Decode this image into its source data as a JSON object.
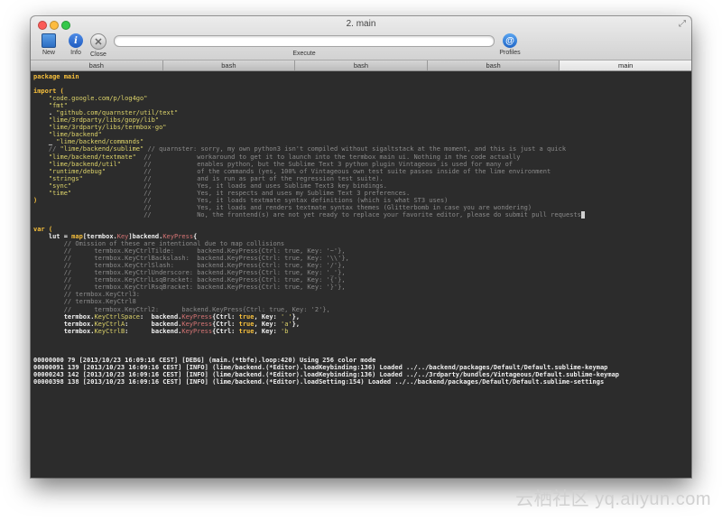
{
  "window": {
    "title": "2. main"
  },
  "toolbar": {
    "new_label": "New",
    "info_label": "Info",
    "close_label": "Close",
    "execute_label": "Execute",
    "execute_value": "",
    "profiles_label": "Profiles",
    "profiles_glyph": "@",
    "info_glyph": "i",
    "close_glyph": "✕"
  },
  "tabs": [
    {
      "label": "bash",
      "active": false
    },
    {
      "label": "bash",
      "active": false
    },
    {
      "label": "bash",
      "active": false
    },
    {
      "label": "bash",
      "active": false
    },
    {
      "label": "main",
      "active": true
    }
  ],
  "terminal": {
    "lines": [
      [
        [
          "k",
          "package main"
        ]
      ],
      [],
      [
        [
          "k",
          "import ("
        ]
      ],
      [
        [
          "s",
          "    \"code.google.com/p/log4go\""
        ]
      ],
      [
        [
          "s",
          "    \"fmt\""
        ]
      ],
      [
        [
          "w",
          "    . "
        ],
        [
          "s",
          "\"github.com/quarnster/util/text\""
        ]
      ],
      [
        [
          "s",
          "    \"lime/3rdparty/libs/gopy/lib\""
        ]
      ],
      [
        [
          "s",
          "    \"lime/3rdparty/libs/termbox-go\""
        ]
      ],
      [
        [
          "s",
          "    \"lime/backend\""
        ]
      ],
      [
        [
          "w",
          "    _ "
        ],
        [
          "s",
          "\"lime/backend/commands\""
        ]
      ],
      [
        [
          "c",
          "    // "
        ],
        [
          "s",
          "\"lime/backend/sublime\""
        ],
        [
          "c",
          " // quarnster: sorry, my own python3 isn't compiled without sigaltstack at the moment, and this is just a quick"
        ]
      ],
      [
        [
          "s",
          "    \"lime/backend/textmate\""
        ],
        [
          "c",
          "  //            workaround to get it to launch into the termbox main ui. Nothing in the code actually"
        ]
      ],
      [
        [
          "s",
          "    \"lime/backend/util\""
        ],
        [
          "c",
          "      //            enables python, but the Sublime Text 3 python plugin Vintageous is used for many of"
        ]
      ],
      [
        [
          "s",
          "    \"runtime/debug\""
        ],
        [
          "c",
          "          //            of the commands (yes, 100% of Vintageous own test suite passes inside of the lime environment"
        ]
      ],
      [
        [
          "s",
          "    \"strings\""
        ],
        [
          "c",
          "                //            and is run as part of the regression test suite)."
        ]
      ],
      [
        [
          "s",
          "    \"sync\""
        ],
        [
          "c",
          "                   //            Yes, it loads and uses Sublime Text3 key bindings."
        ]
      ],
      [
        [
          "s",
          "    \"time\""
        ],
        [
          "c",
          "                   //            Yes, it respects and uses my Sublime Text 3 preferences."
        ]
      ],
      [
        [
          "k",
          ")"
        ],
        [
          "c",
          "                            //            Yes, it loads textmate syntax definitions (which is what ST3 uses)"
        ]
      ],
      [
        [
          "c",
          "                             //            Yes, it loads and renders textmate syntax themes (Glitterbomb in case you are wondering)"
        ]
      ],
      [
        [
          "c",
          "                             //            No, the frontend(s) are not yet ready to replace your favorite editor, please do submit pull requests"
        ],
        [
          "cursor",
          " "
        ]
      ],
      [],
      [
        [
          "k",
          "var ("
        ]
      ],
      [
        [
          "w",
          "    lut = "
        ],
        [
          "k",
          "map"
        ],
        [
          "w",
          "[termbox."
        ],
        [
          "f",
          "Key"
        ],
        [
          "w",
          "]backend."
        ],
        [
          "f",
          "KeyPress"
        ],
        [
          "w",
          "{"
        ]
      ],
      [
        [
          "c",
          "        // Omission of these are intentional due to map collisions"
        ]
      ],
      [
        [
          "c",
          "        //      termbox.KeyCtrlTilde:      backend.KeyPress{Ctrl: true, Key: '~'},"
        ]
      ],
      [
        [
          "c",
          "        //      termbox.KeyCtrlBackslash:  backend.KeyPress{Ctrl: true, Key: '\\\\'},"
        ]
      ],
      [
        [
          "c",
          "        //      termbox.KeyCtrlSlash:      backend.KeyPress{Ctrl: true, Key: '/'},"
        ]
      ],
      [
        [
          "c",
          "        //      termbox.KeyCtrlUnderscore: backend.KeyPress{Ctrl: true, Key: '_'},"
        ]
      ],
      [
        [
          "c",
          "        //      termbox.KeyCtrlLsqBracket: backend.KeyPress{Ctrl: true, Key: '{'},"
        ]
      ],
      [
        [
          "c",
          "        //      termbox.KeyCtrlRsqBracket: backend.KeyPress{Ctrl: true, Key: '}'},"
        ]
      ],
      [
        [
          "c",
          "        // termbox.KeyCtrl3:"
        ]
      ],
      [
        [
          "c",
          "        // termbox.KeyCtrl8"
        ]
      ],
      [
        [
          "c",
          "        //      termbox.KeyCtrl2:      backend.KeyPress{Ctrl: true, Key: '2'},"
        ]
      ],
      [
        [
          "w",
          "        termbox."
        ],
        [
          "s",
          "KeyCtrlSpace"
        ],
        [
          "w",
          ":  backend."
        ],
        [
          "f",
          "KeyPress"
        ],
        [
          "w",
          "{Ctrl: "
        ],
        [
          "k",
          "true"
        ],
        [
          "w",
          ", Key: "
        ],
        [
          "s",
          "' '"
        ],
        [
          "w",
          "},"
        ]
      ],
      [
        [
          "w",
          "        termbox."
        ],
        [
          "s",
          "KeyCtrlA"
        ],
        [
          "w",
          ":      backend."
        ],
        [
          "f",
          "KeyPress"
        ],
        [
          "w",
          "{Ctrl: "
        ],
        [
          "k",
          "true"
        ],
        [
          "w",
          ", Key: "
        ],
        [
          "s",
          "'a'"
        ],
        [
          "w",
          "},"
        ]
      ],
      [
        [
          "w",
          "        termbox."
        ],
        [
          "s",
          "KeyCtrlB"
        ],
        [
          "w",
          ":      backend."
        ],
        [
          "f",
          "KeyPress"
        ],
        [
          "w",
          "{Ctrl: "
        ],
        [
          "k",
          "true"
        ],
        [
          "w",
          ", Key: "
        ],
        [
          "s",
          "'b"
        ]
      ],
      [],
      [],
      [],
      [
        [
          "w",
          "00000000 79 [2013/10/23 16:09:16 CEST] [DEBG] (main.(*tbfe).loop:420) Using 256 color mode"
        ]
      ],
      [
        [
          "w",
          "00000091 139 [2013/10/23 16:09:16 CEST] [INFO] (lime/backend.(*Editor).loadKeybinding:136) Loaded ../../backend/packages/Default/Default.sublime-keymap"
        ]
      ],
      [
        [
          "w",
          "00000243 142 [2013/10/23 16:09:16 CEST] [INFO] (lime/backend.(*Editor).loadKeybinding:136) Loaded ../../3rdparty/bundles/Vintageous/Default.sublime-keymap"
        ]
      ],
      [
        [
          "w",
          "00000398 138 [2013/10/23 16:09:16 CEST] [INFO] (lime/backend.(*Editor).loadSetting:154) Loaded ../../backend/packages/Default/Default.sublime-settings"
        ]
      ]
    ]
  },
  "watermark": "云栖社区 yq.aliyun.com"
}
